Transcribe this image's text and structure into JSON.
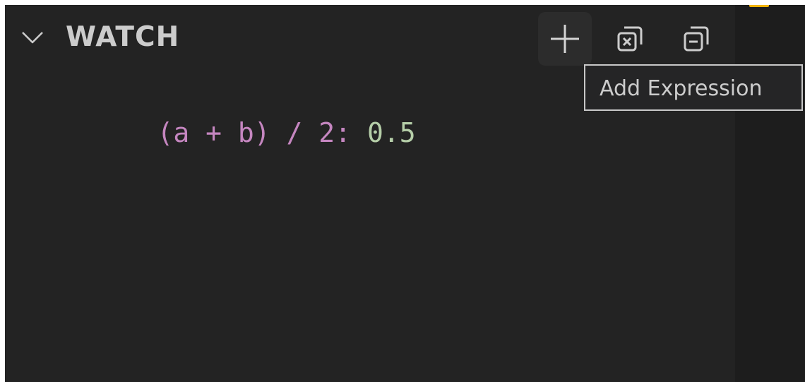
{
  "watch_panel": {
    "title": "WATCH",
    "actions": [
      {
        "name": "add-expression",
        "icon": "plus-icon"
      },
      {
        "name": "collapse-all",
        "icon": "collapse-all-icon"
      },
      {
        "name": "remove-all",
        "icon": "remove-all-icon"
      }
    ],
    "tooltip": "Add Expression",
    "expressions": [
      {
        "expression": "(a + b) / 2",
        "separator": ": ",
        "value": "0.5"
      }
    ]
  },
  "colors": {
    "background": "#232323",
    "expression": "#c586c0",
    "value": "#b5cea8",
    "title": "#cccccc",
    "accent": "#f2b300"
  }
}
